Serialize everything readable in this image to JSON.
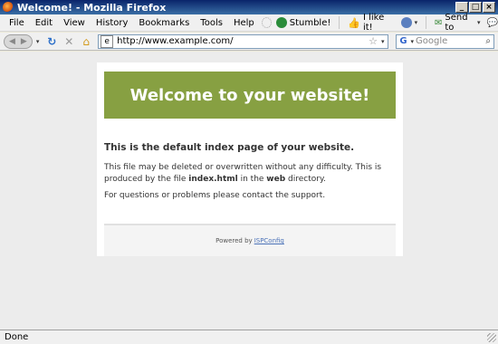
{
  "window": {
    "title": "Welcome! - Mozilla Firefox"
  },
  "menu": {
    "items": [
      "File",
      "Edit",
      "View",
      "History",
      "Bookmarks",
      "Tools",
      "Help"
    ],
    "addons": {
      "stumble": "Stumble!",
      "like": "I like it!",
      "send_to": "Send to"
    }
  },
  "nav": {
    "url": "http://www.example.com/",
    "search_placeholder": "Google"
  },
  "page": {
    "banner": "Welcome to your website!",
    "heading": "This is the default index page of your website.",
    "para1_pre": "This file may be deleted or overwritten without any difficulty. This is produced by the file ",
    "para1_file": "index.html",
    "para1_mid": " in the ",
    "para1_dir": "web",
    "para1_post": " directory.",
    "para2": "For questions or problems please contact the support.",
    "footer_text": "Powered by",
    "footer_link": "ISPConfig"
  },
  "status": {
    "text": "Done"
  },
  "colors": {
    "banner": "#87a042",
    "titlebar": "#0a246a"
  }
}
